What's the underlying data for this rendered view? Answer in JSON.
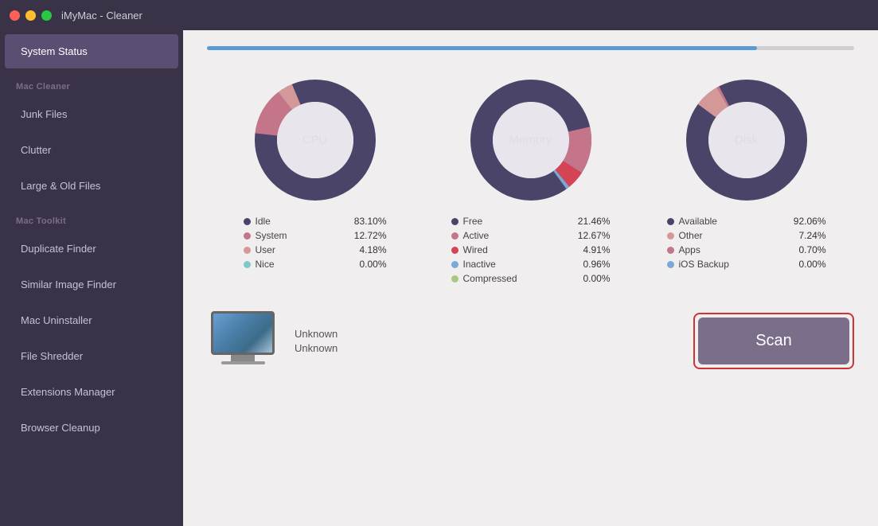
{
  "titlebar": {
    "title": "iMyMac - Cleaner"
  },
  "sidebar": {
    "active_item": "System Status",
    "items": [
      {
        "id": "system-status",
        "label": "System Status",
        "type": "item",
        "active": true
      },
      {
        "id": "mac-cleaner-header",
        "label": "Mac Cleaner",
        "type": "header"
      },
      {
        "id": "junk-files",
        "label": "Junk Files",
        "type": "item"
      },
      {
        "id": "clutter",
        "label": "Clutter",
        "type": "item"
      },
      {
        "id": "large-old-files",
        "label": "Large & Old Files",
        "type": "item"
      },
      {
        "id": "mac-toolkit-header",
        "label": "Mac Toolkit",
        "type": "header"
      },
      {
        "id": "duplicate-finder",
        "label": "Duplicate Finder",
        "type": "item"
      },
      {
        "id": "similar-image-finder",
        "label": "Similar Image Finder",
        "type": "item"
      },
      {
        "id": "mac-uninstaller",
        "label": "Mac Uninstaller",
        "type": "item"
      },
      {
        "id": "file-shredder",
        "label": "File Shredder",
        "type": "item"
      },
      {
        "id": "extensions-manager",
        "label": "Extensions Manager",
        "type": "item"
      },
      {
        "id": "browser-cleanup",
        "label": "Browser Cleanup",
        "type": "item"
      }
    ]
  },
  "progress": {
    "value": 85
  },
  "charts": {
    "cpu": {
      "label": "CPU",
      "segments": [
        {
          "name": "Idle",
          "value": 83.1,
          "color": "#4a4468",
          "percent": 83.1
        },
        {
          "name": "System",
          "value": 12.72,
          "color": "#c4758a",
          "percent": 12.72
        },
        {
          "name": "User",
          "value": 4.18,
          "color": "#d49898",
          "percent": 4.18
        },
        {
          "name": "Nice",
          "value": 0.0,
          "color": "#7ec8c8",
          "percent": 0.0
        }
      ],
      "legend": [
        {
          "name": "Idle",
          "value": "83.10%",
          "color": "#4a4468"
        },
        {
          "name": "System",
          "value": "12.72%",
          "color": "#c4758a"
        },
        {
          "name": "User",
          "value": "4.18%",
          "color": "#d49898"
        },
        {
          "name": "Nice",
          "value": "0.00%",
          "color": "#7ec8c8"
        }
      ]
    },
    "memory": {
      "label": "Memory",
      "segments": [
        {
          "name": "Free",
          "value": 21.46,
          "color": "#4a4468",
          "percent": 21.46
        },
        {
          "name": "Active",
          "value": 12.67,
          "color": "#c4758a",
          "percent": 12.67
        },
        {
          "name": "Wired",
          "value": 4.91,
          "color": "#d44455",
          "percent": 4.91
        },
        {
          "name": "Inactive",
          "value": 0.96,
          "color": "#7ba8d4",
          "percent": 0.96
        },
        {
          "name": "Compressed",
          "value": 0.0,
          "color": "#a8c880",
          "percent": 0.0
        }
      ],
      "legend": [
        {
          "name": "Free",
          "value": "21.46%",
          "color": "#4a4468"
        },
        {
          "name": "Active",
          "value": "12.67%",
          "color": "#c4758a"
        },
        {
          "name": "Wired",
          "value": "4.91%",
          "color": "#d44455"
        },
        {
          "name": "Inactive",
          "value": "0.96%",
          "color": "#7ba8d4"
        },
        {
          "name": "Compressed",
          "value": "0.00%",
          "color": "#a8c880"
        }
      ]
    },
    "disk": {
      "label": "Disk",
      "segments": [
        {
          "name": "Available",
          "value": 92.06,
          "color": "#4a4468",
          "percent": 92.06
        },
        {
          "name": "Other",
          "value": 7.24,
          "color": "#d49898",
          "percent": 7.24
        },
        {
          "name": "Apps",
          "value": 0.7,
          "color": "#c4758a",
          "percent": 0.7
        },
        {
          "name": "iOS Backup",
          "value": 0.0,
          "color": "#7ba8d4",
          "percent": 0.0
        }
      ],
      "legend": [
        {
          "name": "Available",
          "value": "92.06%",
          "color": "#4a4468"
        },
        {
          "name": "Other",
          "value": "7.24%",
          "color": "#d49898"
        },
        {
          "name": "Apps",
          "value": "0.70%",
          "color": "#c4758a"
        },
        {
          "name": "iOS Backup",
          "value": "0.00%",
          "color": "#7ba8d4"
        }
      ]
    }
  },
  "device": {
    "line1": "Unknown",
    "line2": "Unknown"
  },
  "scan_button": {
    "label": "Scan"
  }
}
